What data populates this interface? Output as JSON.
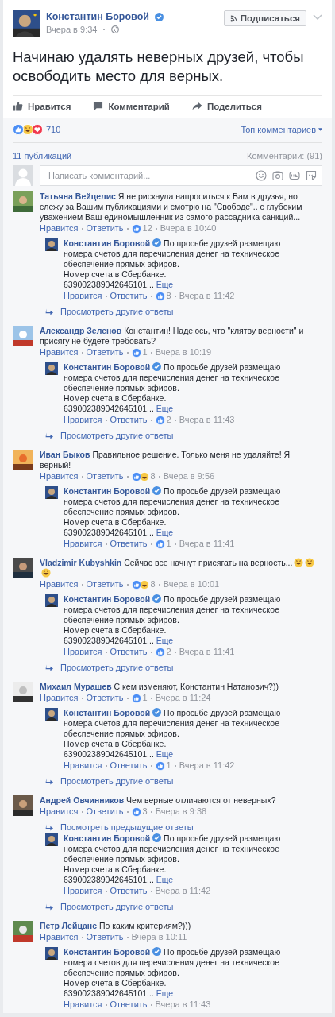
{
  "post": {
    "author": "Константин Боровой",
    "verified": true,
    "time": "Вчера в 9:34",
    "follow_button": "Подписаться",
    "text": "Начинаю удалять неверных друзей, чтобы освободить место для верных."
  },
  "actions": [
    {
      "kind": "like",
      "label": "Нравится"
    },
    {
      "kind": "comment",
      "label": "Комментарий"
    },
    {
      "kind": "share",
      "label": "Поделиться"
    }
  ],
  "reactions": {
    "kinds": [
      {
        "kind": "like"
      },
      {
        "kind": "haha"
      },
      {
        "kind": "love"
      }
    ],
    "count": "710"
  },
  "sort": "Топ комментариев",
  "shares": "11 публикаций",
  "comments_count": "Комментарии: (91)",
  "composer": {
    "placeholder": "Написать комментарий..."
  },
  "comments": [
    {
      "author": "Татьяна Вейцелис",
      "text": "Я не рискнула напроситься к Вам в друзья, но слежу за Вашим публикациями и смотрю на \"Свободе\".. с глубоким уважением Ваш единомышленник из самого рассадника санкций...",
      "like": "Нравится",
      "reply": "Ответить",
      "reactions": [
        {
          "kind": "like"
        }
      ],
      "count": "12",
      "time": "Вчера в 10:40",
      "replies": [
        {
          "author": "Константин Боровой",
          "verified": true,
          "text": "По просьбе друзей размещаю номера счетов для перечисления денег на техническое обеспечение прямых эфиров.",
          "lines": [
            "Номер счета в Сбербанке."
          ],
          "cut": "639002389042645101...",
          "more": "Еще",
          "like": "Нравится",
          "reply": "Ответить",
          "reactions": [
            {
              "kind": "like"
            }
          ],
          "count": "8",
          "time": "Вчера в 11:42"
        }
      ],
      "after_link": "Просмотреть другие ответы"
    },
    {
      "author": "Александр Зеленов",
      "text": "Константин! Надеюсь, что \"клятву верности\" и присягу не будете требовать?",
      "like": "Нравится",
      "reply": "Ответить",
      "reactions": [
        {
          "kind": "like"
        }
      ],
      "count": "1",
      "time": "Вчера в 10:19",
      "replies": [
        {
          "author": "Константин Боровой",
          "verified": true,
          "text": "По просьбе друзей размещаю номера счетов для перечисления денег на техническое обеспечение прямых эфиров.",
          "lines": [
            "Номер счета в Сбербанке."
          ],
          "cut": "639002389042645101...",
          "more": "Еще",
          "like": "Нравится",
          "reply": "Ответить",
          "reactions": [
            {
              "kind": "like"
            }
          ],
          "count": "2",
          "time": "Вчера в 11:43"
        }
      ],
      "after_link": "Просмотреть другие ответы"
    },
    {
      "author": "Иван Быков",
      "text": "Правильное решение. Только меня не удаляйте! Я верный!",
      "like": "Нравится",
      "reply": "Ответить",
      "reactions": [
        {
          "kind": "like"
        },
        {
          "kind": "haha"
        }
      ],
      "count": "8",
      "time": "Вчера в 9:56",
      "replies": [
        {
          "author": "Константин Боровой",
          "verified": true,
          "text": "По просьбе друзей размещаю номера счетов для перечисления денег на техническое обеспечение прямых эфиров.",
          "lines": [
            "Номер счета в Сбербанке."
          ],
          "cut": "639002389042645101...",
          "more": "Еще",
          "like": "Нравится",
          "reply": "Ответить",
          "reactions": [
            {
              "kind": "like"
            }
          ],
          "count": "1",
          "time": "Вчера в 11:41"
        }
      ]
    },
    {
      "author": "Vladzimir Kubyshkin",
      "text": "Сейчас все начнут присягать на верность...",
      "emojis": [
        {
          "kind": "haha"
        },
        {
          "kind": "haha"
        },
        {
          "kind": "haha"
        }
      ],
      "like": "Нравится",
      "reply": "Ответить",
      "reactions": [
        {
          "kind": "like"
        },
        {
          "kind": "haha"
        }
      ],
      "count": "8",
      "time": "Вчера в 10:01",
      "replies": [
        {
          "author": "Константин Боровой",
          "verified": true,
          "text": "По просьбе друзей размещаю номера счетов для перечисления денег на техническое обеспечение прямых эфиров.",
          "lines": [
            "Номер счета в Сбербанке."
          ],
          "cut": "639002389042645101...",
          "more": "Еще",
          "like": "Нравится",
          "reply": "Ответить",
          "reactions": [
            {
              "kind": "like"
            }
          ],
          "count": "2",
          "time": "Вчера в 11:41"
        }
      ],
      "after_link": "Просмотреть другие ответы"
    },
    {
      "author": "Михаил Мурашев",
      "text": "С кем изменяют, Константин Натанович?))",
      "like": "Нравится",
      "reply": "Ответить",
      "reactions": [
        {
          "kind": "like"
        }
      ],
      "count": "1",
      "time": "Вчера в 11:24",
      "replies": [
        {
          "author": "Константин Боровой",
          "verified": true,
          "text": "По просьбе друзей размещаю номера счетов для перечисления денег на техническое обеспечение прямых эфиров.",
          "lines": [
            "Номер счета в Сбербанке."
          ],
          "cut": "639002389042645101...",
          "more": "Еще",
          "like": "Нравится",
          "reply": "Ответить",
          "reactions": [
            {
              "kind": "like"
            }
          ],
          "count": "1",
          "time": "Вчера в 11:42"
        }
      ],
      "after_link": "Просмотреть другие ответы"
    },
    {
      "author": "Андрей Овчинников",
      "text": "Чем верные отличаются от неверных?",
      "like": "Нравится",
      "reply": "Ответить",
      "reactions": [
        {
          "kind": "like"
        }
      ],
      "count": "3",
      "time": "Вчера в 9:38",
      "before_link": "Посмотреть предыдущие ответы",
      "replies": [
        {
          "author": "Константин Боровой",
          "verified": true,
          "text": "По просьбе друзей размещаю номера счетов для перечисления денег на техническое обеспечение прямых эфиров.",
          "lines": [
            "Номер счета в Сбербанке."
          ],
          "cut": "639002389042645101...",
          "more": "Еще",
          "like": "Нравится",
          "reply": "Ответить",
          "time": "Вчера в 11:42"
        }
      ],
      "after_link": "Просмотреть другие ответы"
    },
    {
      "author": "Петр Лейцанс",
      "text": "По каким критериям?)))",
      "like": "Нравится",
      "reply": "Ответить",
      "time": "Вчера в 10:11",
      "replies": [
        {
          "author": "Константин Боровой",
          "verified": true,
          "text": "По просьбе друзей размещаю номера счетов для перечисления денег на техническое обеспечение прямых эфиров.",
          "lines": [
            "Номер счета в Сбербанке."
          ],
          "cut": "639002389042645101...",
          "more": "Еще",
          "like": "Нравится",
          "reply": "Ответить",
          "time": "Вчера в 11:43"
        }
      ]
    }
  ]
}
